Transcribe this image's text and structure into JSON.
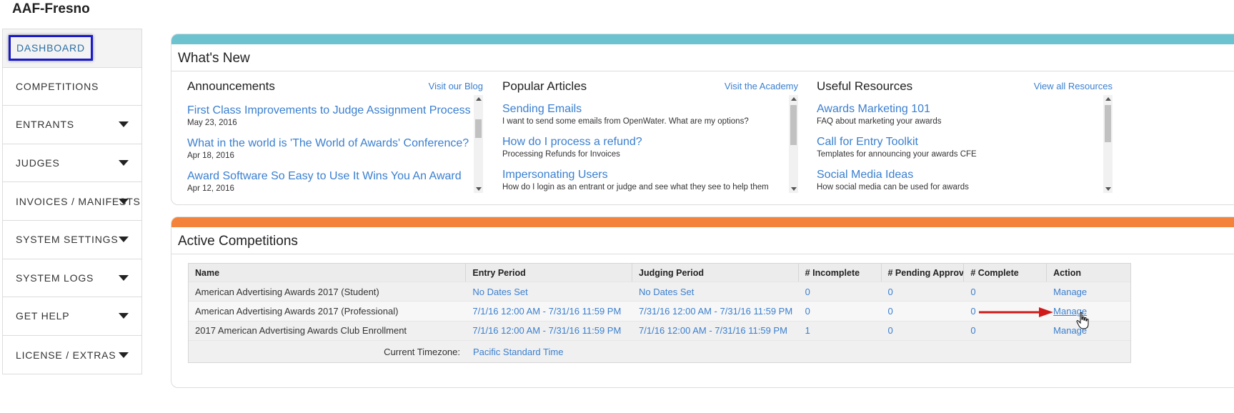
{
  "org": {
    "title": "AAF-Fresno"
  },
  "sidebar": {
    "items": [
      {
        "label": "DASHBOARD",
        "has_caret": false,
        "active": true
      },
      {
        "label": "COMPETITIONS",
        "has_caret": false
      },
      {
        "label": "ENTRANTS",
        "has_caret": true
      },
      {
        "label": "JUDGES",
        "has_caret": true
      },
      {
        "label": "INVOICES / MANIFESTS",
        "has_caret": true
      },
      {
        "label": "SYSTEM SETTINGS",
        "has_caret": true
      },
      {
        "label": "SYSTEM LOGS",
        "has_caret": true
      },
      {
        "label": "GET HELP",
        "has_caret": true
      },
      {
        "label": "LICENSE / EXTRAS",
        "has_caret": true
      }
    ]
  },
  "whats_new": {
    "title": "What's New",
    "bar_color": "#6cc3cf",
    "announcements": {
      "title": "Announcements",
      "link": "Visit our Blog",
      "items": [
        {
          "title": "First Class Improvements to Judge Assignment Process",
          "sub": "May 23, 2016"
        },
        {
          "title": "What in the world is 'The World of Awards' Conference?",
          "sub": "Apr 18, 2016"
        },
        {
          "title": "Award Software So Easy to Use It Wins You An Award",
          "sub": "Apr 12, 2016"
        }
      ]
    },
    "articles": {
      "title": "Popular Articles",
      "link": "Visit the Academy",
      "items": [
        {
          "title": "Sending Emails",
          "sub": "I want to send some emails from OpenWater. What are my options?"
        },
        {
          "title": "How do I process a refund?",
          "sub": "Processing Refunds for Invoices"
        },
        {
          "title": "Impersonating Users",
          "sub": "How do I login as an entrant or judge and see what they see to help them"
        }
      ]
    },
    "resources": {
      "title": "Useful Resources",
      "link": "View all Resources",
      "items": [
        {
          "title": "Awards Marketing 101",
          "sub": "FAQ about marketing your awards"
        },
        {
          "title": "Call for Entry Toolkit",
          "sub": "Templates for announcing your awards CFE"
        },
        {
          "title": "Social Media Ideas",
          "sub": "How social media can be used for awards"
        }
      ]
    }
  },
  "active": {
    "title": "Active Competitions",
    "bar_color": "#f5823a",
    "columns": [
      "Name",
      "Entry Period",
      "Judging Period",
      "# Incomplete",
      "# Pending Approval",
      "# Complete",
      "Action"
    ],
    "rows": [
      {
        "name": "American Advertising Awards 2017 (Student)",
        "entry": "No Dates Set",
        "judging": "No Dates Set",
        "incomplete": "0",
        "pending": "0",
        "complete": "0",
        "action": "Manage"
      },
      {
        "name": "American Advertising Awards 2017 (Professional)",
        "entry": "7/1/16 12:00 AM - 7/31/16 11:59 PM",
        "judging": "7/31/16 12:00 AM - 7/31/16 11:59 PM",
        "incomplete": "0",
        "pending": "0",
        "complete": "0",
        "action": "Manage"
      },
      {
        "name": "2017 American Advertising Awards Club Enrollment",
        "entry": "7/1/16 12:00 AM - 7/31/16 11:59 PM",
        "judging": "7/1/16 12:00 AM - 7/31/16 11:59 PM",
        "incomplete": "1",
        "pending": "0",
        "complete": "0",
        "action": "Manage"
      }
    ],
    "timezone_label": "Current Timezone:",
    "timezone_value": "Pacific Standard Time"
  },
  "colors": {
    "link": "#3a7fcf",
    "highlight_box": "#1a1ac8",
    "arrow": "#d01a1a"
  },
  "icons": {
    "caret": "caret-down-icon",
    "pointer": "hand-cursor-icon",
    "arrow": "red-arrow-icon"
  }
}
